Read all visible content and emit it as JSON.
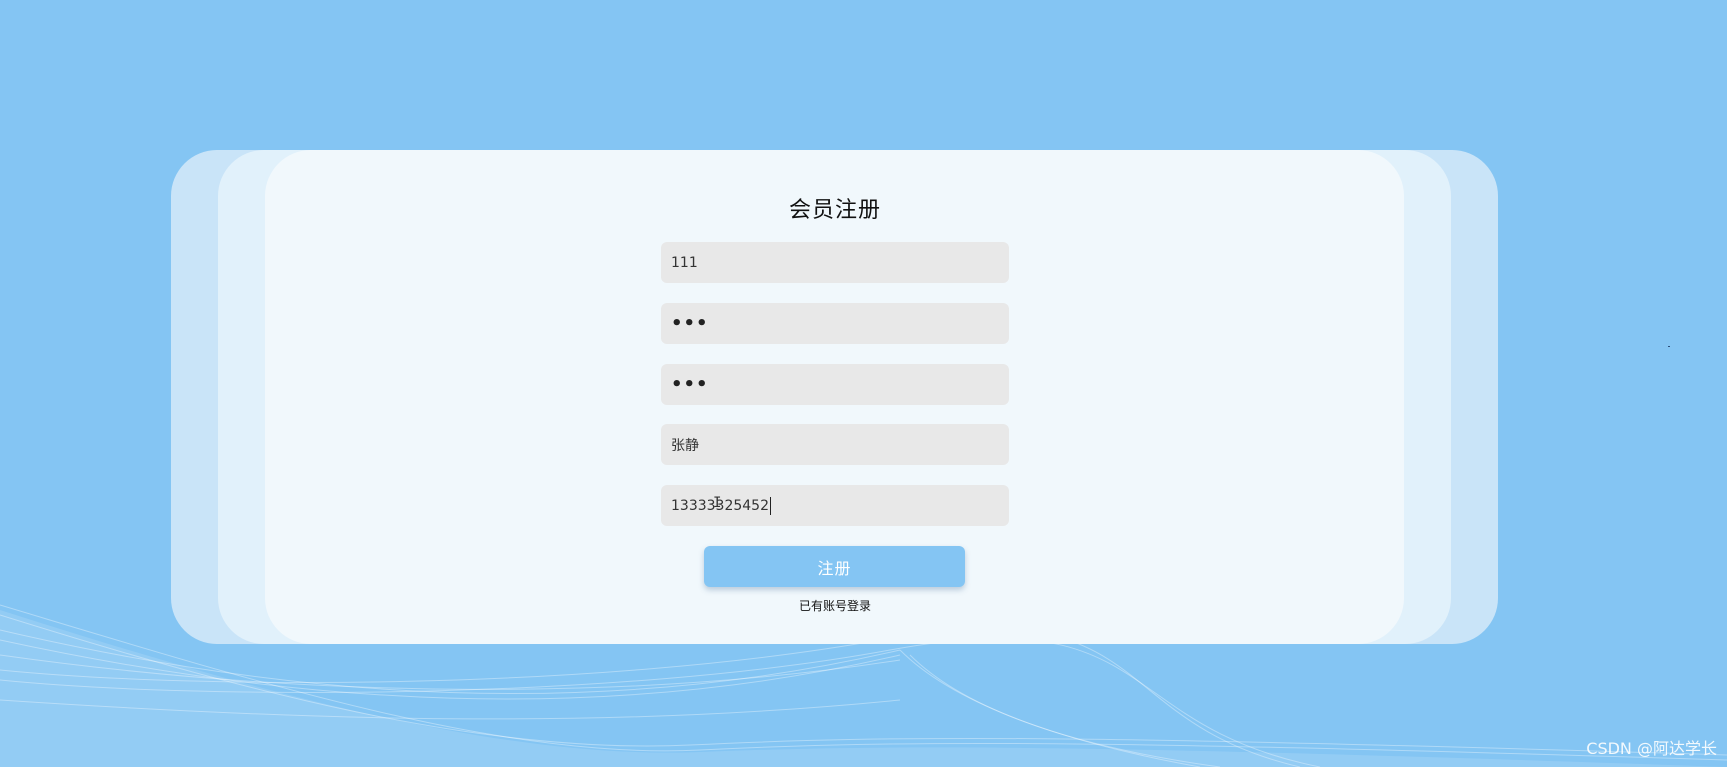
{
  "colors": {
    "background": "#84c5f3",
    "card": "#f1f8fc",
    "input": "#e8e8e8",
    "button": "#84c5f3"
  },
  "form": {
    "title": "会员注册",
    "fields": [
      {
        "name": "username",
        "value": "111",
        "type": "text"
      },
      {
        "name": "password",
        "value": "•••",
        "type": "password"
      },
      {
        "name": "confirm-password",
        "value": "•••",
        "type": "password"
      },
      {
        "name": "real-name",
        "value": "张静",
        "type": "text"
      },
      {
        "name": "phone",
        "value": "13333325452",
        "type": "text"
      }
    ],
    "submit_label": "注册",
    "login_link": "已有账号登录"
  },
  "watermark": "CSDN @阿达学长"
}
